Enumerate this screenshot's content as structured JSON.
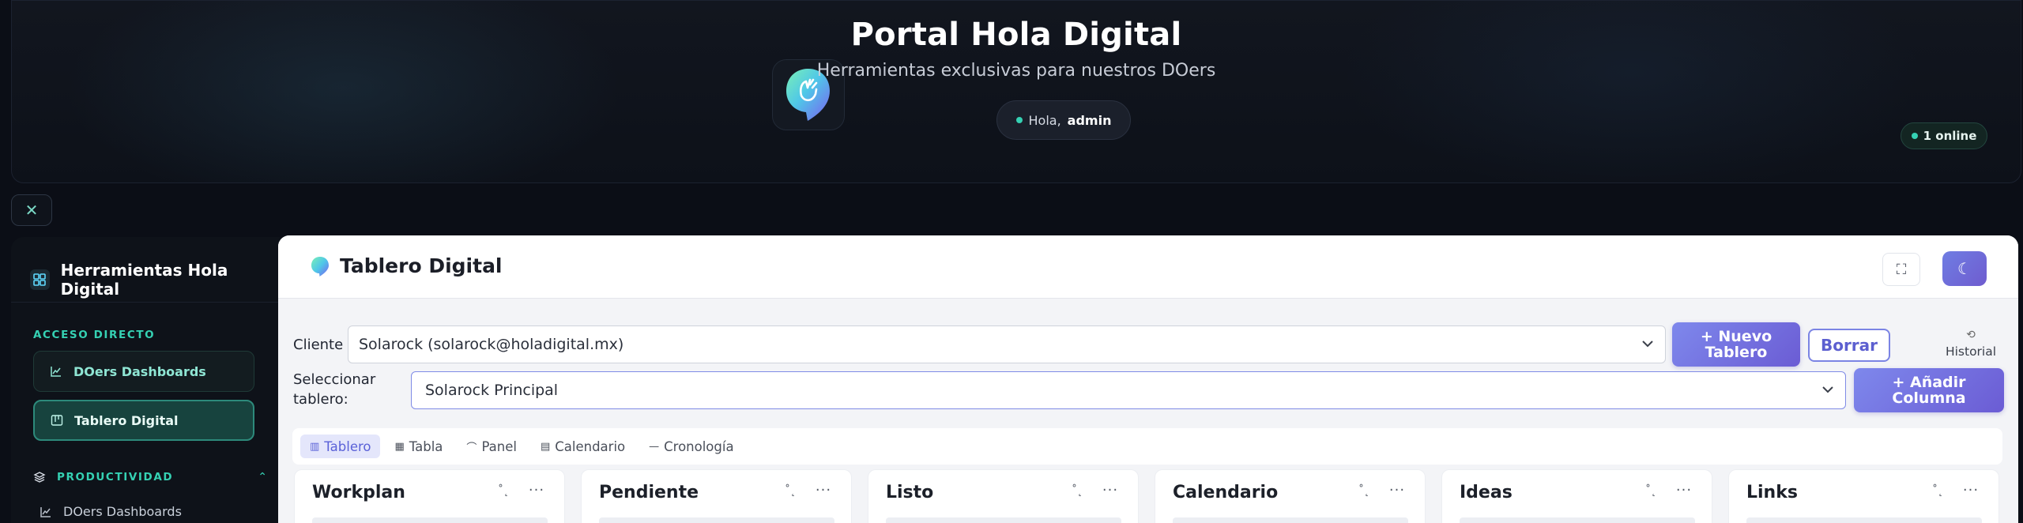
{
  "hero": {
    "title": "Portal Hola Digital",
    "subtitle": "Herramientas exclusivas para nuestros DOers",
    "greeting_prefix": "Hola,",
    "greeting_user": "admin",
    "online": "1 online"
  },
  "close_label": "✕",
  "sidebar": {
    "title": "Herramientas Hola Digital",
    "section_direct": "ACCESO DIRECTO",
    "items": [
      {
        "label": "DOers Dashboards",
        "active": false
      },
      {
        "label": "Tablero Digital",
        "active": true
      }
    ],
    "section_productivity": "PRODUCTIVIDAD",
    "sub_items": [
      {
        "label": "DOers Dashboards"
      }
    ]
  },
  "main": {
    "title": "Tablero Digital",
    "client_label": "Cliente",
    "client_value": "Solarock (solarock@holadigital.mx)",
    "new_board_button": "+ Nuevo Tablero",
    "delete_button": "Borrar",
    "history_label": "Historial",
    "select_board_label": "Seleccionar tablero:",
    "board_value": "Solarock Principal",
    "add_column_button": "+ Añadir Columna",
    "tabs": [
      {
        "label": "Tablero",
        "icon": "board-icon",
        "active": true
      },
      {
        "label": "Tabla",
        "icon": "table-icon",
        "active": false
      },
      {
        "label": "Panel",
        "icon": "panel-icon",
        "active": false
      },
      {
        "label": "Calendario",
        "icon": "calendar-icon",
        "active": false
      },
      {
        "label": "Cronología",
        "icon": "timeline-icon",
        "active": false
      }
    ],
    "columns": [
      {
        "title": "Workplan"
      },
      {
        "title": "Pendiente"
      },
      {
        "title": "Listo"
      },
      {
        "title": "Calendario"
      },
      {
        "title": "Ideas"
      },
      {
        "title": "Links"
      }
    ],
    "column_sort_glyph": "˚˛",
    "column_more_glyph": "···"
  },
  "colors": {
    "accent": "#35d1b3",
    "primary": "#6f5ccf",
    "background_dark": "#0b0e16"
  }
}
